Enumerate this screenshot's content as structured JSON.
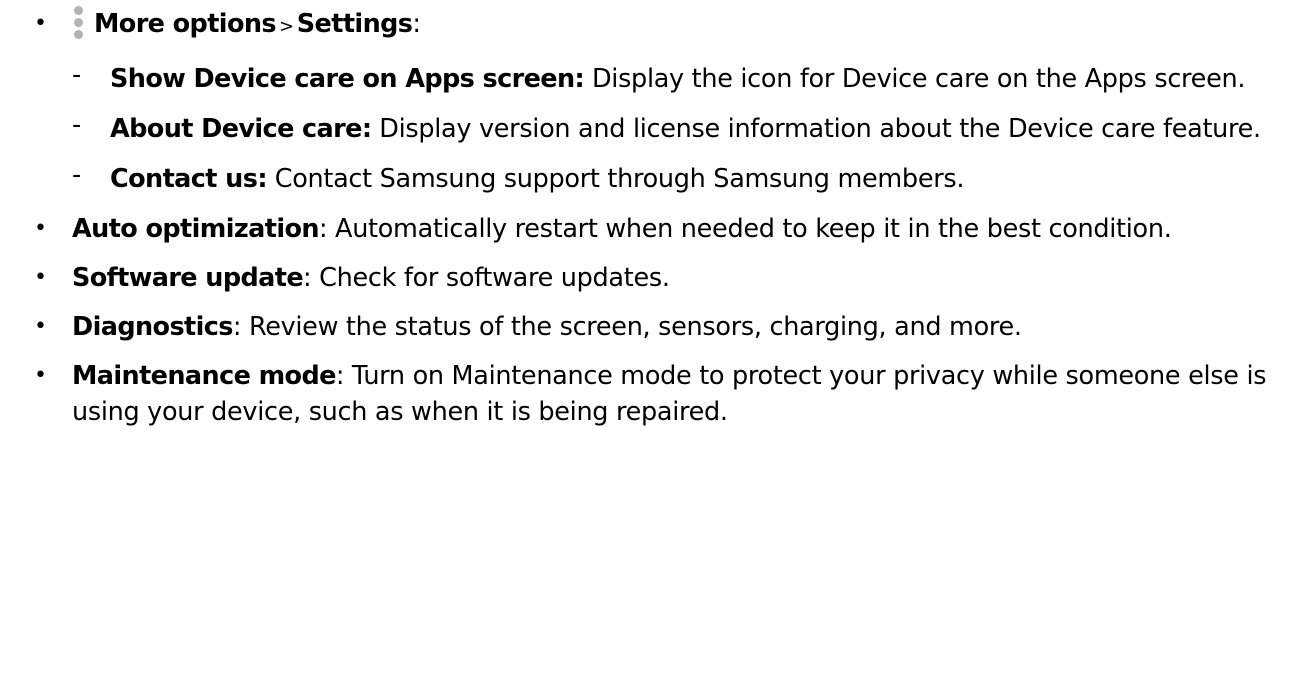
{
  "bullet_symbol": "•",
  "dash_symbol": "-",
  "icon": "more-options-vertical-dots-icon",
  "icon_color": "#b3b3b3",
  "top_item": {
    "label": "More options",
    "separator": ">",
    "target": "Settings",
    "suffix": ":"
  },
  "settings_items": [
    {
      "title": "Show Device care on Apps screen",
      "colon": ":",
      "text": " Display the icon for Device care on the Apps screen."
    },
    {
      "title": "About Device care",
      "colon": ":",
      "text": " Display version and license information about the Device care feature."
    },
    {
      "title": "Contact us",
      "colon": ":",
      "text": " Contact Samsung support through Samsung members."
    }
  ],
  "main_items": [
    {
      "title": "Auto optimization",
      "colon": ":",
      "text": " Automatically restart when needed to keep it in the best condition."
    },
    {
      "title": "Software update",
      "colon": ":",
      "text": " Check for software updates."
    },
    {
      "title": "Diagnostics",
      "colon": ":",
      "text": " Review the status of the screen, sensors, charging, and more."
    },
    {
      "title": "Maintenance mode",
      "colon": ":",
      "text": " Turn on Maintenance mode to protect your privacy while someone else is using your device, such as when it is being repaired."
    }
  ]
}
